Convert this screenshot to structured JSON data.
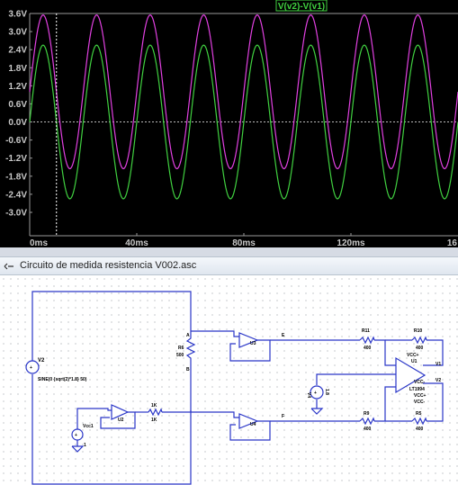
{
  "waveform": {
    "trace_label": "V(v2)-V(v1)",
    "y_ticks": [
      "3.6V",
      "3.0V",
      "2.4V",
      "1.8V",
      "1.2V",
      "0.6V",
      "0.0V",
      "-0.6V",
      "-1.2V",
      "-1.8V",
      "-2.4V",
      "-3.0V"
    ],
    "x_ticks": [
      "0ms",
      "40ms",
      "80ms",
      "120ms",
      "16"
    ],
    "colors": {
      "background": "#000000",
      "trace_magenta": "#e040e0",
      "trace_green": "#40d040",
      "grid": "#8a8a8a"
    }
  },
  "chart_data": {
    "type": "line",
    "xlabel": "",
    "ylabel": "",
    "x_unit": "ms",
    "xlim": [
      0,
      160
    ],
    "ylim": [
      -3.0,
      3.6
    ],
    "series": [
      {
        "name": "V(v2)-V(v1)",
        "frequency_hz": 50,
        "offset_v": 1.0,
        "amplitude_v": 2.55,
        "color": "#e040e0"
      },
      {
        "frequency_hz": 50,
        "offset_v": 0.0,
        "amplitude_v": 2.55,
        "color": "#40d040"
      }
    ],
    "cursor_x_ms": 10
  },
  "schematic": {
    "window_title": "Circuito de medida resistencia V002.asc",
    "labels": {
      "v2": "V2",
      "v2_value": "SINE(0 {sqrt(2)*1.8} 50)",
      "r6": "R6",
      "r6_value": "500",
      "node_a": "A",
      "node_b": "B",
      "u3": "U3",
      "u4": "U4",
      "node_e": "E",
      "node_f": "F",
      "r11": "R11",
      "r11_value": "400",
      "r10": "R10",
      "r10_value": "400",
      "r9": "R9",
      "r9_value": "400",
      "r5": "R5",
      "r5_value": "400",
      "u1": "U1",
      "u1_part": "LT1994",
      "vcc_plus": "VCC+",
      "vcc_minus": "VCC-",
      "vcc_plus_2": "VCC+",
      "vcc_minus_2": "VCC-",
      "v1": "V1",
      "v2_out": "V2",
      "v4": "V4",
      "v4_value": "1.8",
      "vcc1": "Vcc1",
      "vcc1_value": "1",
      "u2": "U2",
      "r1k": "1K",
      "r1k_value": "1K"
    }
  }
}
